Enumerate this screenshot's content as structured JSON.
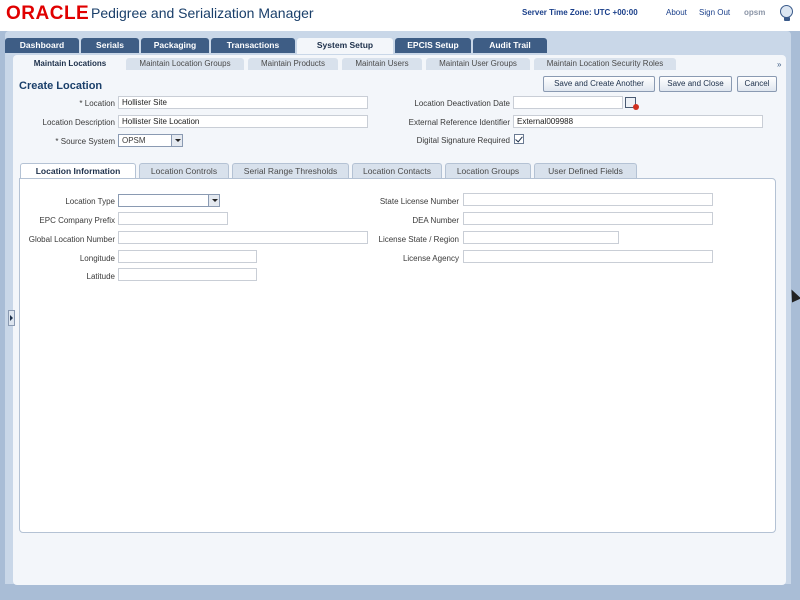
{
  "header": {
    "brand": "ORACLE",
    "app_title": "Pedigree and Serialization Manager",
    "server_time_zone": "Server Time Zone: UTC +00:00",
    "about": "About",
    "sign_out": "Sign Out",
    "user": "opsm"
  },
  "top_tabs": [
    "Dashboard",
    "Serials",
    "Packaging",
    "Transactions",
    "System Setup",
    "EPCIS Setup",
    "Audit Trail"
  ],
  "sub_tabs": [
    "Maintain Locations",
    "Maintain Location Groups",
    "Maintain Products",
    "Maintain Users",
    "Maintain User Groups",
    "Maintain Location Security Roles"
  ],
  "sub_tabs_more": "»",
  "page": {
    "title": "Create Location",
    "buttons": {
      "save_create_another": "Save and Create Another",
      "save_close": "Save and Close",
      "cancel": "Cancel"
    }
  },
  "form": {
    "location_label": "* Location",
    "location_value": "Hollister Site",
    "description_label": "Location Description",
    "description_value": "Hollister Site Location",
    "source_system_label": "* Source System",
    "source_system_value": "OPSM",
    "deactivation_label": "Location Deactivation Date",
    "deactivation_value": "",
    "ext_ref_label": "External Reference Identifier",
    "ext_ref_value": "External009988",
    "digital_sig_label": "Digital Signature Required",
    "digital_sig_checked": true
  },
  "detail_tabs": [
    "Location Information",
    "Location Controls",
    "Serial Range Thresholds",
    "Location Contacts",
    "Location Groups",
    "User Defined Fields"
  ],
  "location_info": {
    "location_type_label": "Location Type",
    "location_type_value": "",
    "epc_prefix_label": "EPC Company Prefix",
    "epc_prefix_value": "",
    "gln_label": "Global Location Number",
    "gln_value": "",
    "longitude_label": "Longitude",
    "longitude_value": "",
    "latitude_label": "Latitude",
    "latitude_value": "",
    "state_license_label": "State License Number",
    "state_license_value": "",
    "dea_label": "DEA Number",
    "dea_value": "",
    "license_state_label": "License State / Region",
    "license_state_value": "",
    "license_agency_label": "License Agency",
    "license_agency_value": ""
  },
  "colors": {
    "brand_red": "#e00000",
    "nav_tab": "#3e5d85",
    "frame": "#a9bdd6",
    "link": "#1a3f8a"
  }
}
